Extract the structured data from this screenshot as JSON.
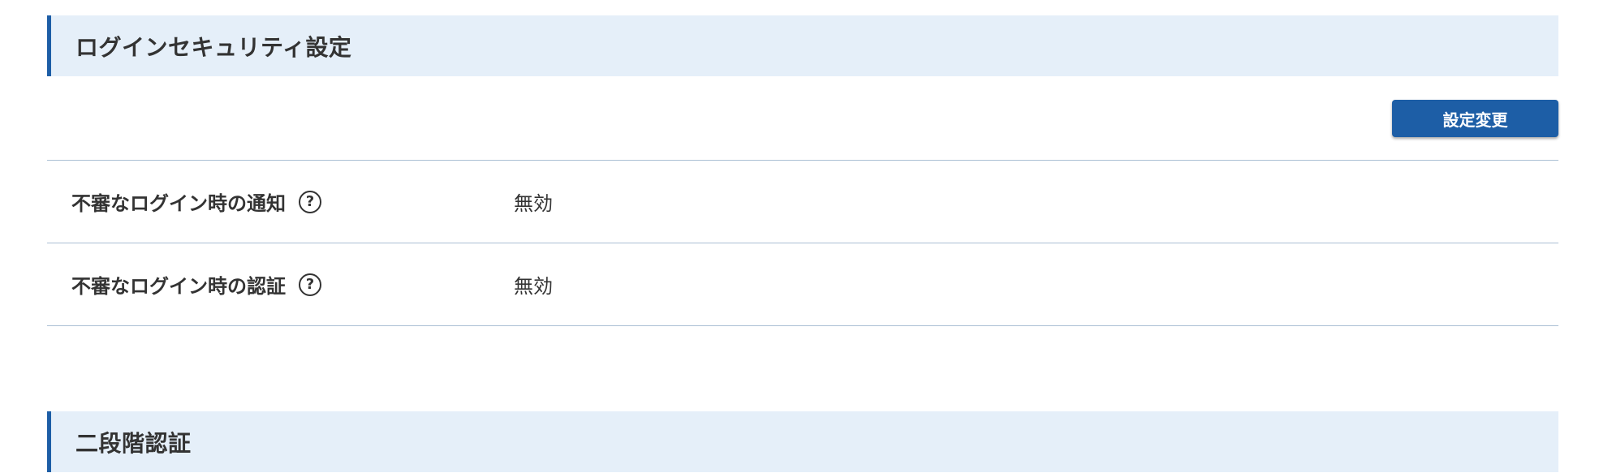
{
  "login_security": {
    "title": "ログインセキュリティ設定",
    "change_button_label": "設定変更",
    "rows": [
      {
        "label": "不審なログイン時の通知",
        "help_glyph": "?",
        "value": "無効"
      },
      {
        "label": "不審なログイン時の認証",
        "help_glyph": "?",
        "value": "無効"
      }
    ]
  },
  "two_factor": {
    "title": "二段階認証"
  },
  "colors": {
    "accent": "#1d5ea6",
    "header_bg": "#e5eff9",
    "divider": "#aabfd4",
    "text": "#333333"
  },
  "icons": {
    "help": "question-circle-icon"
  }
}
